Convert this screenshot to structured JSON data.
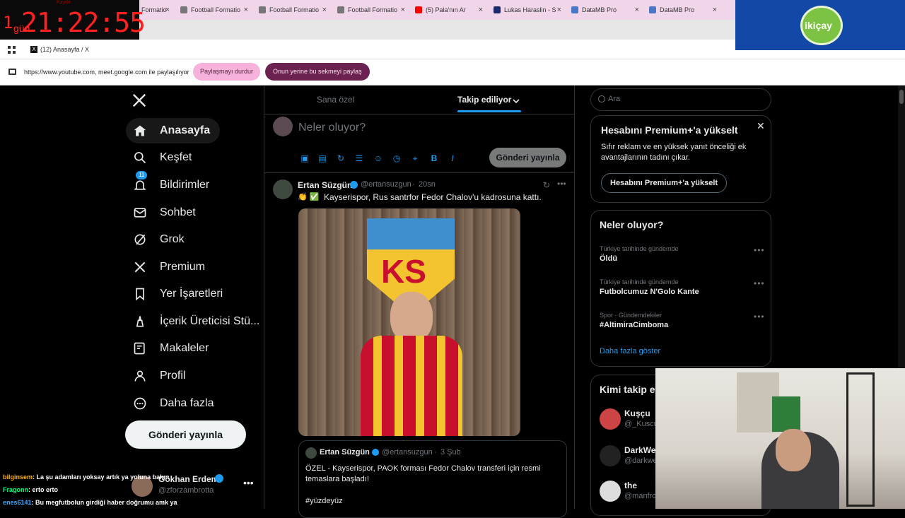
{
  "timer": {
    "top_label": "Kaydır",
    "days": "1",
    "gun": "gün",
    "time": "21:22:55"
  },
  "tabs": [
    {
      "label": "Formatio",
      "fav": "#3c3c3c"
    },
    {
      "label": "Football Formatio",
      "fav": "#777"
    },
    {
      "label": "Football Formatio",
      "fav": "#777"
    },
    {
      "label": "Football Formatio",
      "fav": "#777"
    },
    {
      "label": "(5) Pala'nın Ar",
      "fav": "#ff0000"
    },
    {
      "label": "Lukas Haraslin - S",
      "fav": "#1a2a6c"
    },
    {
      "label": "DataMB Pro",
      "fav": "#4a76c7"
    },
    {
      "label": "DataMB Pro",
      "fav": "#4a76c7"
    }
  ],
  "active_tab": {
    "title": "(12) Anasayfa / X"
  },
  "share": {
    "text": "https://www.youtube.com, meet.google.com ile paylaşılıyor",
    "stop": "Paylaşmayı durdur",
    "share_instead": "Onun yerine bu sekmeyi paylaş"
  },
  "logo": {
    "text": "ikiçay"
  },
  "sidebar": {
    "items": [
      {
        "label": "Anasayfa",
        "icon": "home-icon"
      },
      {
        "label": "Keşfet",
        "icon": "search-icon"
      },
      {
        "label": "Bildirimler",
        "icon": "bell-icon",
        "badge": "11"
      },
      {
        "label": "Sohbet",
        "icon": "envelope-icon"
      },
      {
        "label": "Grok",
        "icon": "grok-icon"
      },
      {
        "label": "Premium",
        "icon": "x-logo-icon"
      },
      {
        "label": "Yer İşaretleri",
        "icon": "bookmark-icon"
      },
      {
        "label": "İçerik Üreticisi Stü...",
        "icon": "creator-icon"
      },
      {
        "label": "Makaleler",
        "icon": "articles-icon"
      },
      {
        "label": "Profil",
        "icon": "person-icon"
      },
      {
        "label": "Daha fazla",
        "icon": "more-circle-icon"
      }
    ],
    "post_button": "Gönderi yayınla",
    "account": {
      "name": "Gökhan Erdem",
      "handle": "@zforzambrotta"
    }
  },
  "main": {
    "tabs": [
      "Sana özel",
      "Takip ediliyor"
    ],
    "composer_placeholder": "Neler oluyor?",
    "composer_button": "Gönderi yayınla",
    "tweet": {
      "name": "Ertan Süzgün",
      "handle": "@ertansuzgun",
      "time": "20sn",
      "text": "Kayserispor, Rus santrfor Fedor Chalov'u kadrosuna kattı.",
      "emoji": "👏 ✅",
      "image_badge": "KS",
      "quote": {
        "name": "Ertan Süzgün",
        "handle": "@ertansuzgun",
        "date": "3 Şub",
        "text": "ÖZEL - Kayserispor, PAOK forması Fedor Chalov transferi için resmi temaslara başladı!",
        "hashtag": "#yüzdeyüz"
      }
    }
  },
  "right": {
    "search_placeholder": "Ara",
    "premium": {
      "title": "Hesabını Premium+'a yükselt",
      "body": "Sıfır reklam ve en yüksek yanıt önceliği ek avantajlarının tadını çıkar.",
      "button": "Hesabını Premium+'a yükselt"
    },
    "trends": {
      "title": "Neler oluyor?",
      "items": [
        {
          "meta": "Türkiye tarihinde gündemde",
          "title": "Öldü"
        },
        {
          "meta": "Türkiye tarihinde gündemde",
          "title": "Futbolcumuz N'Golo Kante"
        },
        {
          "meta": "Spor · Gündemdekiler",
          "title": "#AltimiraCimboma"
        }
      ],
      "more": "Daha fazla göster"
    },
    "who": {
      "title": "Kimi takip et",
      "items": [
        {
          "name": "Kuşçu",
          "handle": "@_Kuscu"
        },
        {
          "name": "DarkWe",
          "handle": "@darkwe"
        },
        {
          "name": "the",
          "handle": "@manfro"
        }
      ]
    }
  },
  "chat": [
    {
      "user": "bilginsem",
      "color": "#ffb000",
      "msg": ": La şu adamları yoksay artık ya yoluna bakın"
    },
    {
      "user": "Fragonn",
      "color": "#00ff7f",
      "msg": ": erto erto"
    },
    {
      "user": "enes6141",
      "color": "#3fa9ff",
      "msg": ": Bu megfutbolun girdiği haber doğrumu amk ya"
    }
  ],
  "colors": {
    "accent": "#1d9bf0",
    "bg": "#000000",
    "border": "#2f3336",
    "pill_pink": "#f6b2da",
    "pill_purple": "#6b2250"
  }
}
